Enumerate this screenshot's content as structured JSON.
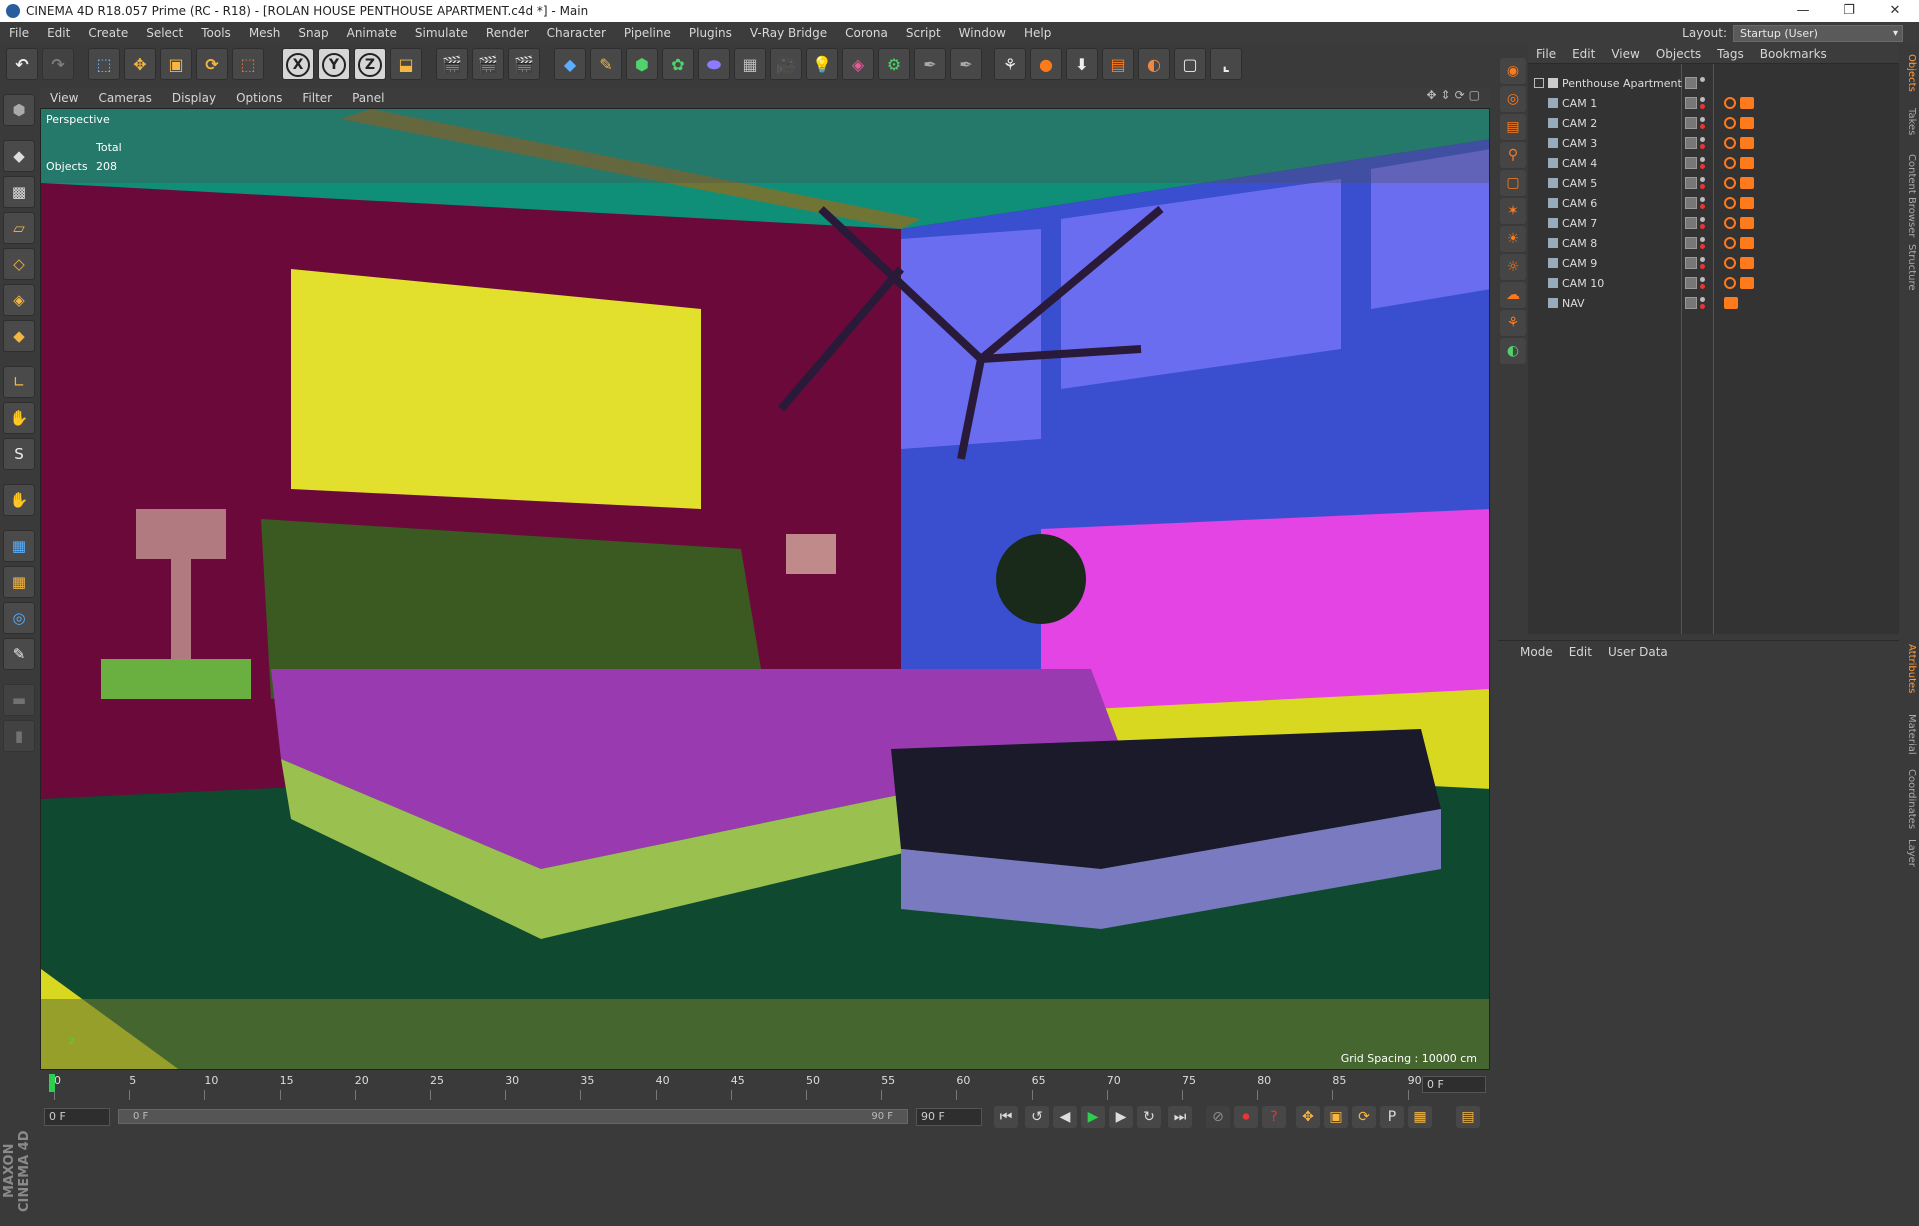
{
  "window": {
    "title": "CINEMA 4D R18.057 Prime (RC - R18) - [ROLAN HOUSE PENTHOUSE APARTMENT.c4d *] - Main"
  },
  "menu": [
    "File",
    "Edit",
    "Create",
    "Select",
    "Tools",
    "Mesh",
    "Snap",
    "Animate",
    "Simulate",
    "Render",
    "Character",
    "Pipeline",
    "Plugins",
    "V-Ray Bridge",
    "Corona",
    "Script",
    "Window",
    "Help"
  ],
  "layout": {
    "label": "Layout:",
    "value": "Startup (User)"
  },
  "viewport": {
    "menu": [
      "View",
      "Cameras",
      "Display",
      "Options",
      "Filter",
      "Panel"
    ],
    "name": "Perspective",
    "stats_header": "Total",
    "stats_label": "Objects",
    "stats_value": "208",
    "grid_spacing": "Grid Spacing : 10000 cm",
    "axis": "z"
  },
  "timeline": {
    "ticks": [
      "0",
      "5",
      "10",
      "15",
      "20",
      "25",
      "30",
      "35",
      "40",
      "45",
      "50",
      "55",
      "60",
      "65",
      "70",
      "75",
      "80",
      "85",
      "90"
    ],
    "current_frame": "0 F",
    "start_frame": "0 F",
    "slider_start": "0 F",
    "slider_end": "90 F",
    "end_frame": "90 F"
  },
  "objects_panel": {
    "menu": [
      "File",
      "Edit",
      "View",
      "Objects",
      "Tags",
      "Bookmarks"
    ],
    "root": "Penthouse Apartment",
    "items": [
      "CAM 1",
      "CAM 2",
      "CAM 3",
      "CAM 4",
      "CAM 5",
      "CAM 6",
      "CAM 7",
      "CAM 8",
      "CAM 9",
      "CAM 10",
      "NAV"
    ]
  },
  "attributes_panel": {
    "menu": [
      "Mode",
      "Edit",
      "User Data"
    ]
  },
  "side_tabs": [
    "Objects",
    "Takes",
    "Content Browser",
    "Structure"
  ],
  "side_tabs_lower": [
    "Attributes",
    "Material",
    "Coordinates",
    "Layer"
  ],
  "brand": "MAXON CINEMA 4D",
  "colors": {
    "accent": "#ff7a1a",
    "playhead": "#2cd04e",
    "bg": "#3a3a3a"
  }
}
